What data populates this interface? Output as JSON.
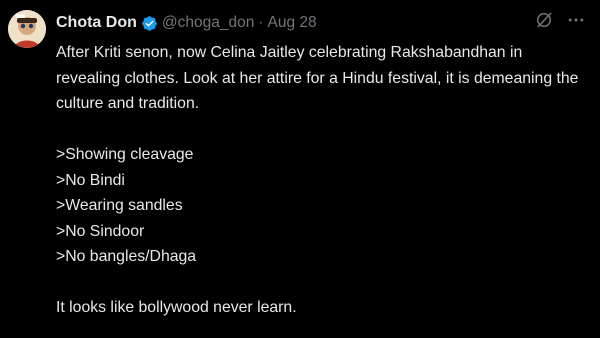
{
  "tweet": {
    "author": {
      "name": "Chota Don",
      "handle": "@choga_don",
      "verified": true,
      "avatar_icon": "profile-avatar"
    },
    "separator": "·",
    "date": "Aug 28",
    "actions": {
      "grok_icon": "grok-icon",
      "more_icon": "more-options-icon"
    },
    "text": {
      "intro": "After Kriti senon, now Celina Jaitley celebrating Rakshabandhan in revealing clothes. Look at her attire for a Hindu festival, it is demeaning the culture and tradition.",
      "points": [
        ">Showing cleavage",
        ">No Bindi",
        ">Wearing sandles",
        ">No Sindoor",
        ">No bangles/Dhaga"
      ],
      "closing": "It looks like bollywood never learn."
    }
  },
  "colors": {
    "background": "#000000",
    "text_primary": "#e7e9ea",
    "text_secondary": "#71767b",
    "verified_badge": "#1d9bf0"
  }
}
